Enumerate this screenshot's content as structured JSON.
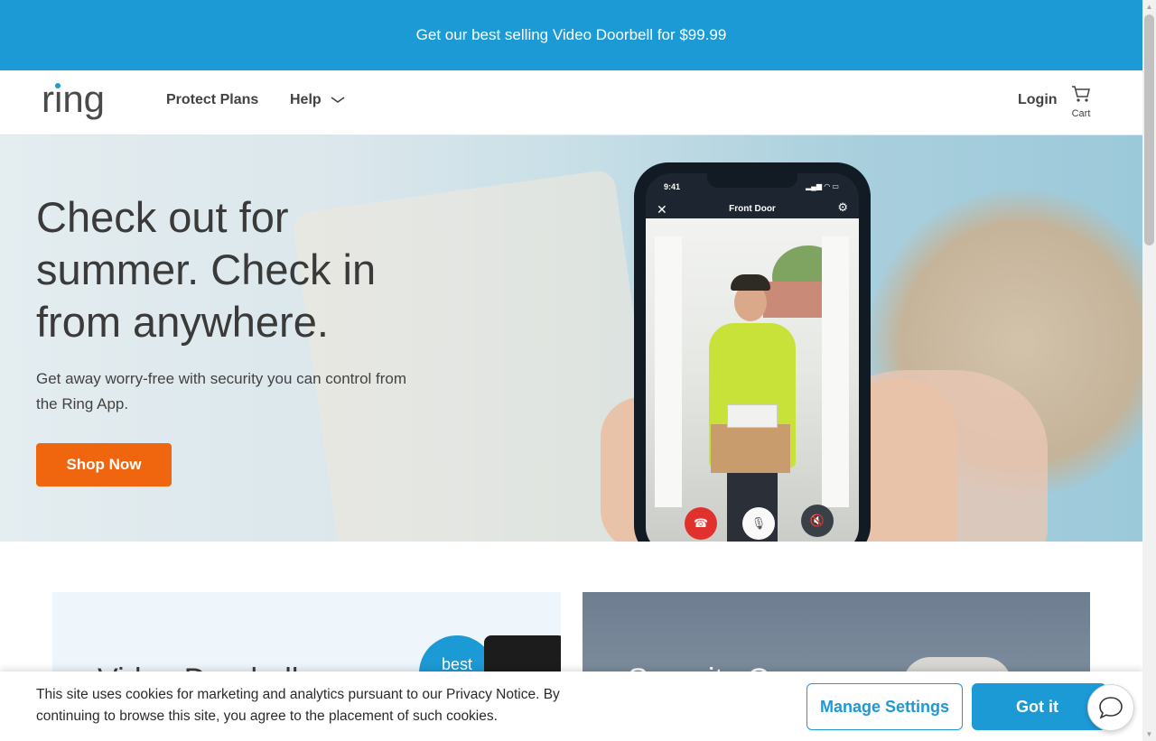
{
  "promo": {
    "text": "Get our best selling Video Doorbell for $99.99"
  },
  "header": {
    "logo_text": "ring",
    "nav": [
      {
        "label": "Protect Plans"
      },
      {
        "label": "Help"
      }
    ],
    "login_label": "Login",
    "cart_label": "Cart"
  },
  "hero": {
    "title": "Check out for summer. Check in from anywhere.",
    "subtitle": "Get away worry-free with security you can control from the Ring App.",
    "cta_label": "Shop Now",
    "phone": {
      "time": "9:41",
      "title": "Front Door"
    }
  },
  "cards": [
    {
      "title": "Video Doorbells",
      "badge": "best"
    },
    {
      "title": "Security Cams"
    }
  ],
  "cookie": {
    "text": "This site uses cookies for marketing and analytics pursuant to our Privacy Notice. By continuing to browse this site, you agree to the placement of such cookies.",
    "manage_label": "Manage Settings",
    "accept_label": "Got it"
  },
  "colors": {
    "brand_blue": "#1c9ad6",
    "cta_orange": "#f0660e",
    "text_dark": "#424242"
  },
  "icons": [
    "chevron-down-icon",
    "cart-icon",
    "close-icon",
    "gear-icon",
    "end-call-icon",
    "microphone-icon",
    "speaker-mute-icon",
    "chat-icon"
  ]
}
